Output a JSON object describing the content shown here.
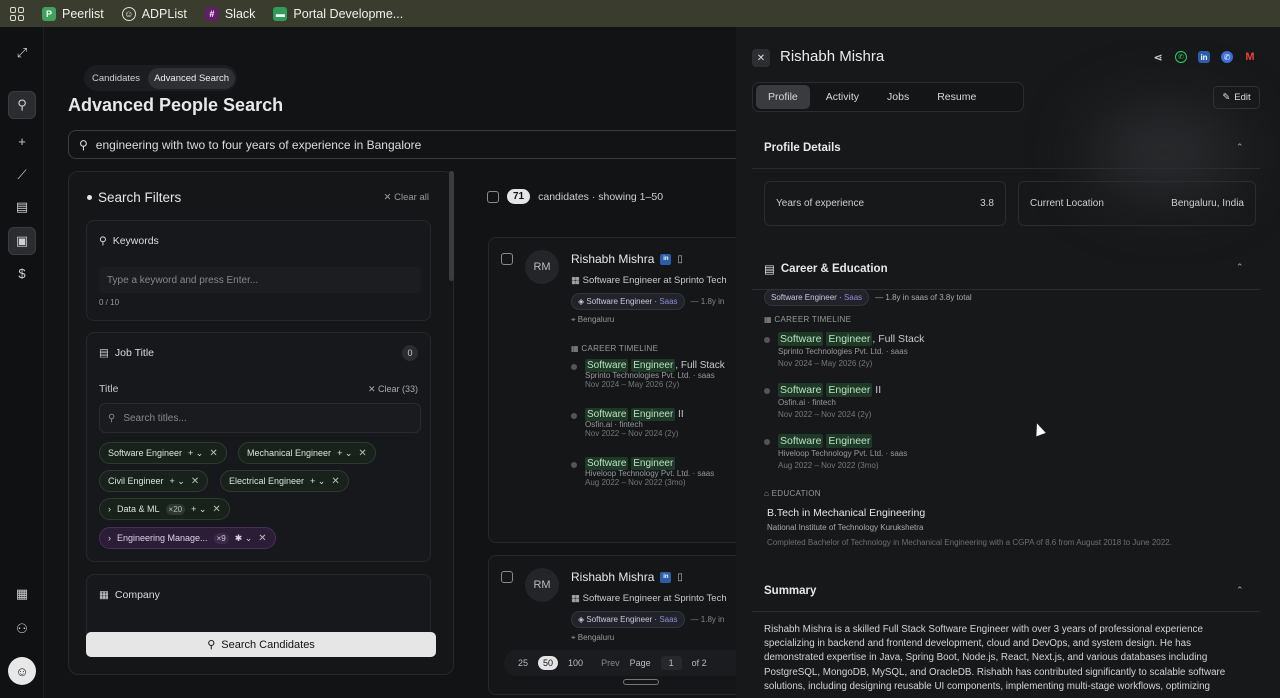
{
  "bookmarks": [
    "Peerlist",
    "ADPList",
    "Slack",
    "Portal Developme..."
  ],
  "seg": [
    "Candidates",
    "Advanced Search"
  ],
  "title": "Advanced People Search",
  "query": "engineering with two to four years of experience in Bangalore",
  "filters": {
    "heading": "Search Filters",
    "clear_all": "Clear all",
    "keywords_label": "Keywords",
    "keywords_placeholder": "Type a keyword and press Enter...",
    "keywords_count": "0 / 10",
    "job_title_label": "Job Title",
    "job_title_badge": "0",
    "title_label": "Title",
    "clear_title": "Clear (33)",
    "search_titles_placeholder": "Search titles...",
    "chips": [
      "Software Engineer",
      "Mechanical Engineer",
      "Civil Engineer",
      "Electrical Engineer",
      "Data & ML",
      "Engineering Manage..."
    ],
    "chip_counts": [
      "×20",
      "×9"
    ],
    "company_label": "Company"
  },
  "search_button": "Search Candidates",
  "results": {
    "count": "71",
    "summary": "candidates · showing 1–50",
    "cards": [
      {
        "initials": "RM",
        "name": "Rishabh Mishra",
        "role": "Software Engineer at Sprinto Tech",
        "chip": "Software Engineer",
        "chip_tag": "Saas",
        "years": "— 1.8y in",
        "location": "Bengaluru",
        "timeline_label": "CAREER TIMELINE",
        "timeline": [
          {
            "t1": "Software",
            "t2": "Engineer",
            ", Full Stack": "",
            "suffix": ", Full Stack",
            "co": "Sprinto Technologies Pvt. Ltd. · saas",
            "dates": "Nov 2024 – May 2026 (2y)"
          },
          {
            "t1": "Software",
            "t2": "Engineer",
            "suffix": " II",
            "co": "Osfin.ai · fintech",
            "dates": "Nov 2022 – Nov 2024 (2y)"
          },
          {
            "t1": "Software",
            "t2": "Engineer",
            "suffix": "",
            "co": "Hiveloop Technology Pvt. Ltd. · saas",
            "dates": "Aug 2022 – Nov 2022 (3mo)"
          }
        ]
      },
      {
        "initials": "RM",
        "name": "Rishabh Mishra",
        "role": "Software Engineer at Sprinto Tech",
        "chip": "Software Engineer",
        "chip_tag": "Saas",
        "years": "— 1.8y in",
        "location": "Bengaluru"
      }
    ]
  },
  "pagination": {
    "sizes": [
      "25",
      "50",
      "100"
    ],
    "prev": "Prev",
    "page_label": "Page",
    "page": "1",
    "of": "of 2"
  },
  "drawer": {
    "name": "Rishabh Mishra",
    "tabs": [
      "Profile",
      "Activity",
      "Jobs",
      "Resume"
    ],
    "edit": "Edit",
    "profile_details": "Profile Details",
    "yoe_label": "Years of experience",
    "yoe": "3.8",
    "loc_label": "Current Location",
    "loc": "Bengaluru, India",
    "career_label": "Career & Education",
    "career_chip": "Software Engineer",
    "career_chip_tag": "Saas",
    "career_total": "— 1.8y in saas of 3.8y total",
    "timeline_label": "CAREER TIMELINE",
    "timeline": [
      {
        "t1": "Software",
        "t2": "Engineer",
        "suffix": ", Full Stack",
        "co": "Sprinto Technologies Pvt. Ltd. · saas",
        "dates": "Nov 2024 – May 2026 (2y)"
      },
      {
        "t1": "Software",
        "t2": "Engineer",
        "suffix": " II",
        "co": "Osfin.ai · fintech",
        "dates": "Nov 2022 – Nov 2024 (2y)"
      },
      {
        "t1": "Software",
        "t2": "Engineer",
        "suffix": "",
        "co": "Hiveloop Technology Pvt. Ltd. · saas",
        "dates": "Aug 2022 – Nov 2022 (3mo)"
      }
    ],
    "education_label": "EDUCATION",
    "degree": "B.Tech in Mechanical Engineering",
    "institute": "National Institute of Technology Kurukshetra",
    "edu_note": "Completed Bachelor of Technology in Mechanical Engineering with a CGPA of 8.6 from August 2018 to June 2022.",
    "summary_label": "Summary",
    "summary": "Rishabh Mishra is a skilled Full Stack Software Engineer with over 3 years of professional experience specializing in backend and frontend development, cloud and DevOps, and system design. He has demonstrated expertise in Java, Spring Boot, Node.js, React, Next.js, and various databases including PostgreSQL, MongoDB, MySQL, and OracleDB. Rishabh has contributed significantly to scalable software solutions, including designing reusable UI components, implementing multi-stage workflows, optimizing"
  }
}
